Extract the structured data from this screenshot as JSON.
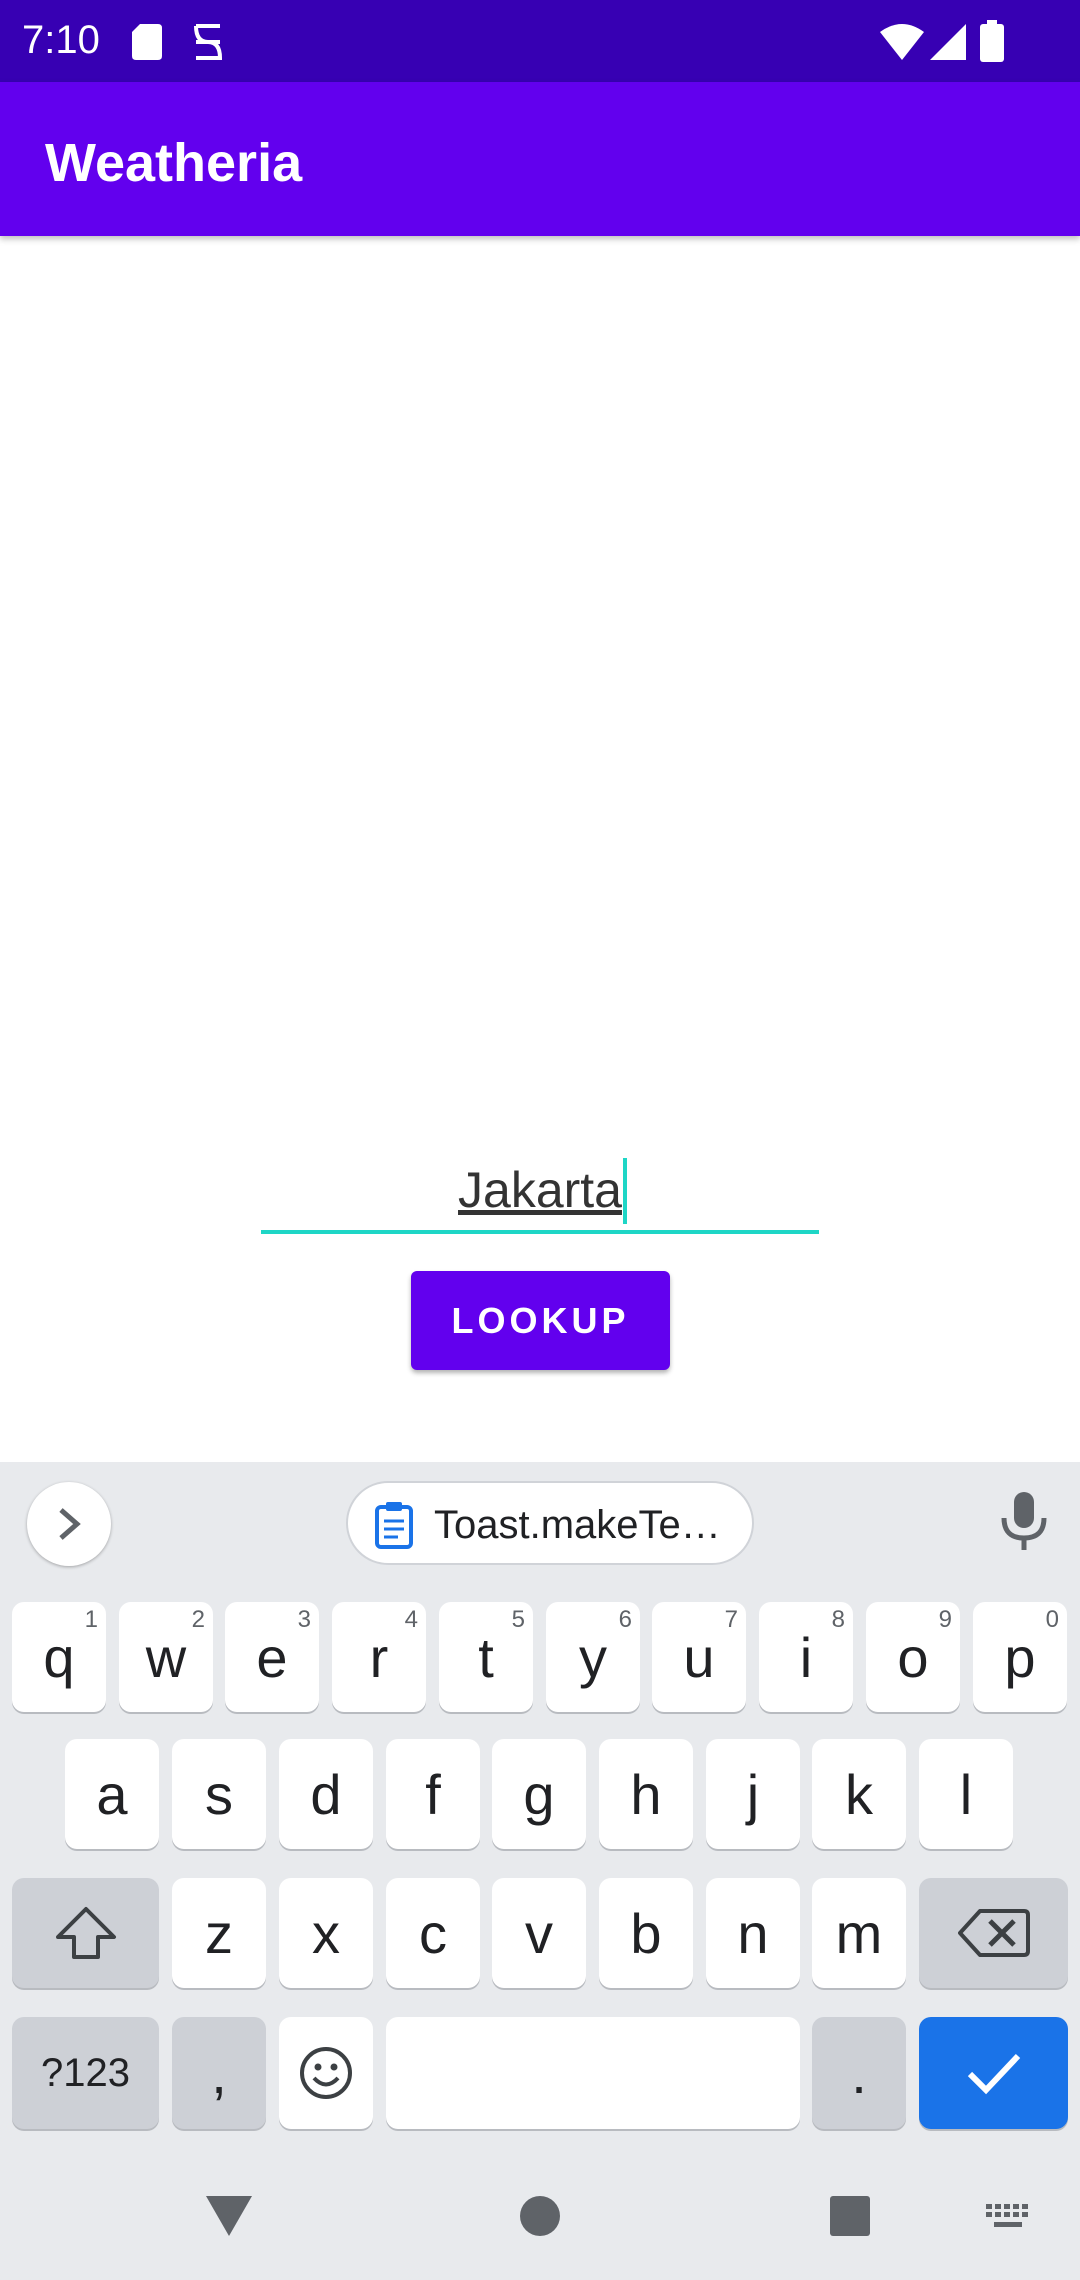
{
  "status_bar": {
    "time": "7:10",
    "icons": [
      "sd-card-icon",
      "screen-record-icon",
      "wifi-icon",
      "signal-icon",
      "battery-icon"
    ]
  },
  "app_bar": {
    "title": "Weatheria"
  },
  "form": {
    "city_value": "Jakarta",
    "lookup_label": "LOOKUP"
  },
  "keyboard": {
    "suggestion_chip": "Toast.makeTe…",
    "row1": [
      {
        "label": "q",
        "hint": "1"
      },
      {
        "label": "w",
        "hint": "2"
      },
      {
        "label": "e",
        "hint": "3"
      },
      {
        "label": "r",
        "hint": "4"
      },
      {
        "label": "t",
        "hint": "5"
      },
      {
        "label": "y",
        "hint": "6"
      },
      {
        "label": "u",
        "hint": "7"
      },
      {
        "label": "i",
        "hint": "8"
      },
      {
        "label": "o",
        "hint": "9"
      },
      {
        "label": "p",
        "hint": "0"
      }
    ],
    "row2": [
      "a",
      "s",
      "d",
      "f",
      "g",
      "h",
      "j",
      "k",
      "l"
    ],
    "row3": [
      "z",
      "x",
      "c",
      "v",
      "b",
      "n",
      "m"
    ],
    "symbols_label": "?123",
    "comma_label": ",",
    "period_label": ".",
    "enter_color": "#1a73e8"
  },
  "colors": {
    "status_bar": "#3700b3",
    "primary": "#6200ee",
    "accent": "#1ed6c6"
  }
}
